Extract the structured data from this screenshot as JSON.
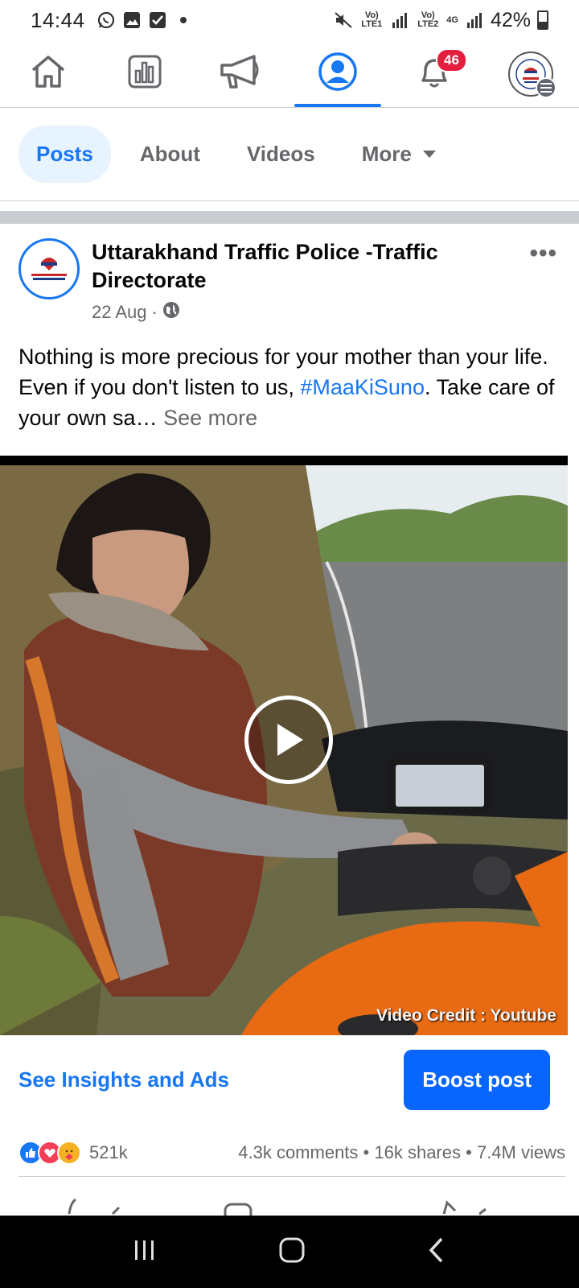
{
  "status_bar": {
    "time": "14:44",
    "left_icons": [
      "whatsapp-icon",
      "gallery-icon",
      "check-icon",
      "dot-icon"
    ],
    "sim1_label": "Vo) LTE1",
    "sim2_label": "Vo) LTE2",
    "network_type": "4G",
    "battery": "42%"
  },
  "top_nav": {
    "items": [
      {
        "icon": "home-icon"
      },
      {
        "icon": "insights-icon"
      },
      {
        "icon": "megaphone-icon"
      },
      {
        "icon": "profile-icon",
        "active": true
      },
      {
        "icon": "bell-icon",
        "badge": "46"
      },
      {
        "icon": "page-avatar-menu-icon"
      }
    ]
  },
  "tabs": {
    "posts": "Posts",
    "about": "About",
    "videos": "Videos",
    "more": "More"
  },
  "post": {
    "page_name": "Uttarakhand Traffic Police -Traffic Directorate",
    "date": "22 Aug",
    "meta_separator": "·",
    "text_before_tag": "Nothing is more precious for your mother than your life. Even if you don't listen to us, ",
    "hashtag": "#MaaKiSuno",
    "text_after_tag": ". Take care of your own sa…",
    "see_more": "See more",
    "video_credit": "Video Credit : Youtube"
  },
  "insights": {
    "link": "See Insights and Ads",
    "boost": "Boost post"
  },
  "stats": {
    "reaction_count": "521k",
    "comments": "4.3k comments",
    "shares": "16k shares",
    "views": "7.4M views",
    "dot": "•"
  },
  "colors": {
    "accent": "#1877f2",
    "boost_button": "#0866ff",
    "badge": "#e41e3f",
    "secondary_text": "#65676b"
  }
}
